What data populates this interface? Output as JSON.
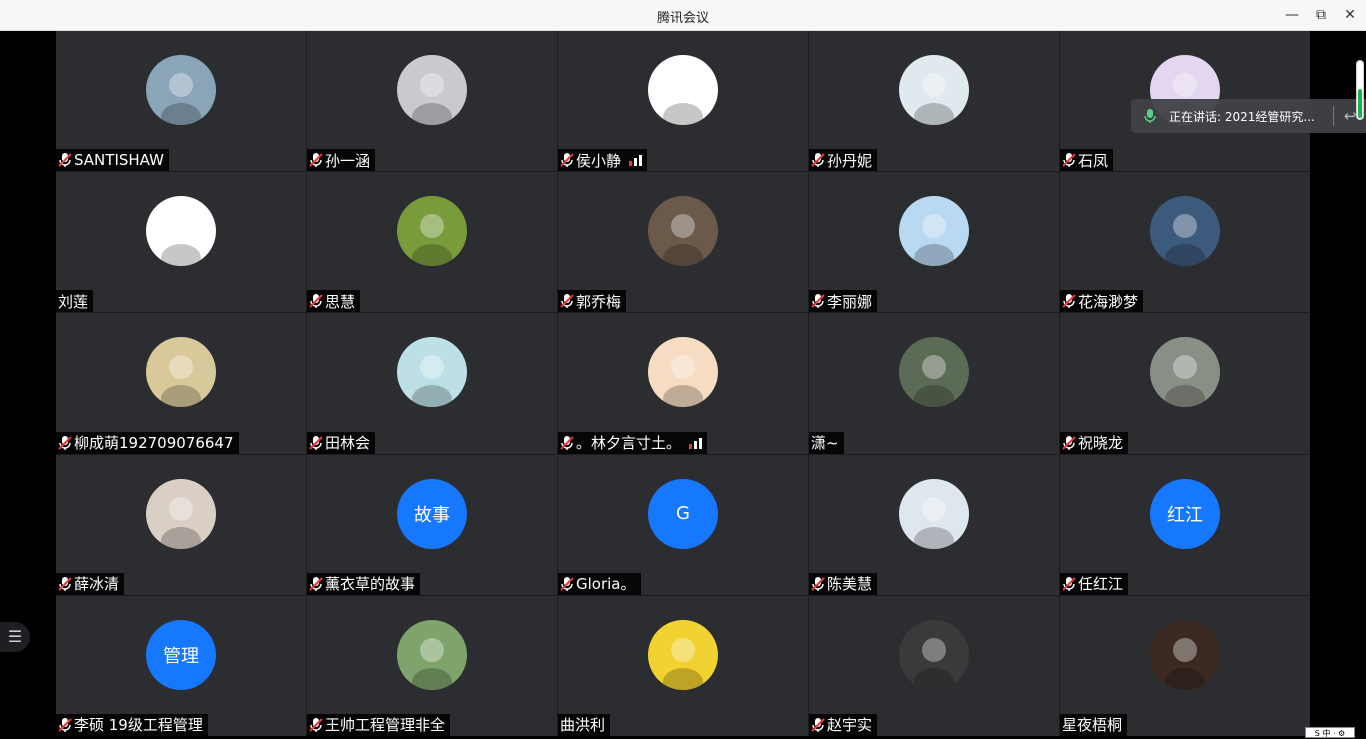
{
  "window": {
    "title": "腾讯会议",
    "minimize": "—",
    "restore": "⧉",
    "close": "✕"
  },
  "speaking": {
    "label": "正在讲话: 2021经管研究...",
    "back": "↩"
  },
  "volume_level": 0.5,
  "ime_label": "S 中 · ⚙",
  "participants": [
    {
      "name": "SANTISHAW",
      "muted": true,
      "avatar": "photo-beach",
      "color": "#8aa4b8",
      "signal": false
    },
    {
      "name": "孙一涵",
      "muted": true,
      "avatar": "cartoon-hat-girl",
      "color": "#c9c9cf",
      "signal": false
    },
    {
      "name": "侯小静",
      "muted": true,
      "avatar": "cartoon-face",
      "color": "#ffffff",
      "signal": true
    },
    {
      "name": "孙丹妮",
      "muted": true,
      "avatar": "photo-sunglasses",
      "color": "#dfe9ee",
      "signal": false
    },
    {
      "name": "石凤",
      "muted": true,
      "avatar": "cartoon-text",
      "color": "#e2d6f0",
      "signal": false
    },
    {
      "name": "刘莲",
      "muted": false,
      "avatar": "cartoon-glasses-girl",
      "color": "#ffffff",
      "signal": false
    },
    {
      "name": "思慧",
      "muted": true,
      "avatar": "photo-snail",
      "color": "#7a9b3c",
      "signal": false
    },
    {
      "name": "郭乔梅",
      "muted": true,
      "avatar": "photo-animal",
      "color": "#6b5a4a",
      "signal": false
    },
    {
      "name": "李丽娜",
      "muted": true,
      "avatar": "photo-sky",
      "color": "#b9d8f2",
      "signal": false
    },
    {
      "name": "花海渺梦",
      "muted": true,
      "avatar": "photo-field",
      "color": "#3c5a7c",
      "signal": false
    },
    {
      "name": "柳成萌192709076647",
      "muted": true,
      "avatar": "cartoon-anime",
      "color": "#d9c89a",
      "signal": false
    },
    {
      "name": "田林会",
      "muted": true,
      "avatar": "cartoon-girl-sea",
      "color": "#bde0e6",
      "signal": false
    },
    {
      "name": "。林夕言寸土。",
      "muted": true,
      "avatar": "cartoon-stewie",
      "color": "#f6dcc2",
      "signal": true
    },
    {
      "name": "潇~",
      "muted": false,
      "avatar": "photo-mountain",
      "color": "#5c6b56",
      "signal": false
    },
    {
      "name": "祝晓龙",
      "muted": true,
      "avatar": "photo-sign",
      "color": "#8a8f86",
      "signal": false
    },
    {
      "name": "薛冰清",
      "muted": true,
      "avatar": "photo-cat",
      "color": "#d9cfc4",
      "signal": false
    },
    {
      "name": "薰衣草的故事",
      "muted": true,
      "avatar_text": "故事",
      "signal": false
    },
    {
      "name": "Gloria。",
      "muted": true,
      "avatar_text": "G",
      "signal": false
    },
    {
      "name": "陈美慧",
      "muted": true,
      "avatar": "photo-snow",
      "color": "#dfe7ee",
      "signal": false
    },
    {
      "name": "任红江",
      "muted": true,
      "avatar_text": "红江",
      "signal": false
    },
    {
      "name": "李硕 19级工程管理",
      "muted": true,
      "avatar_text": "管理",
      "signal": false
    },
    {
      "name": "王帅工程管理非全",
      "muted": true,
      "avatar": "cartoon-vangogh",
      "color": "#7ea36b",
      "signal": false
    },
    {
      "name": "曲洪利",
      "muted": false,
      "avatar": "cartoon-basketball",
      "color": "#f2d230",
      "signal": false
    },
    {
      "name": "赵宇实",
      "muted": true,
      "avatar": "cartoon-robot",
      "color": "#3a3a3a",
      "signal": false
    },
    {
      "name": "星夜梧桐",
      "muted": false,
      "avatar": "photo-portrait",
      "color": "#3c2a22",
      "signal": false
    }
  ]
}
